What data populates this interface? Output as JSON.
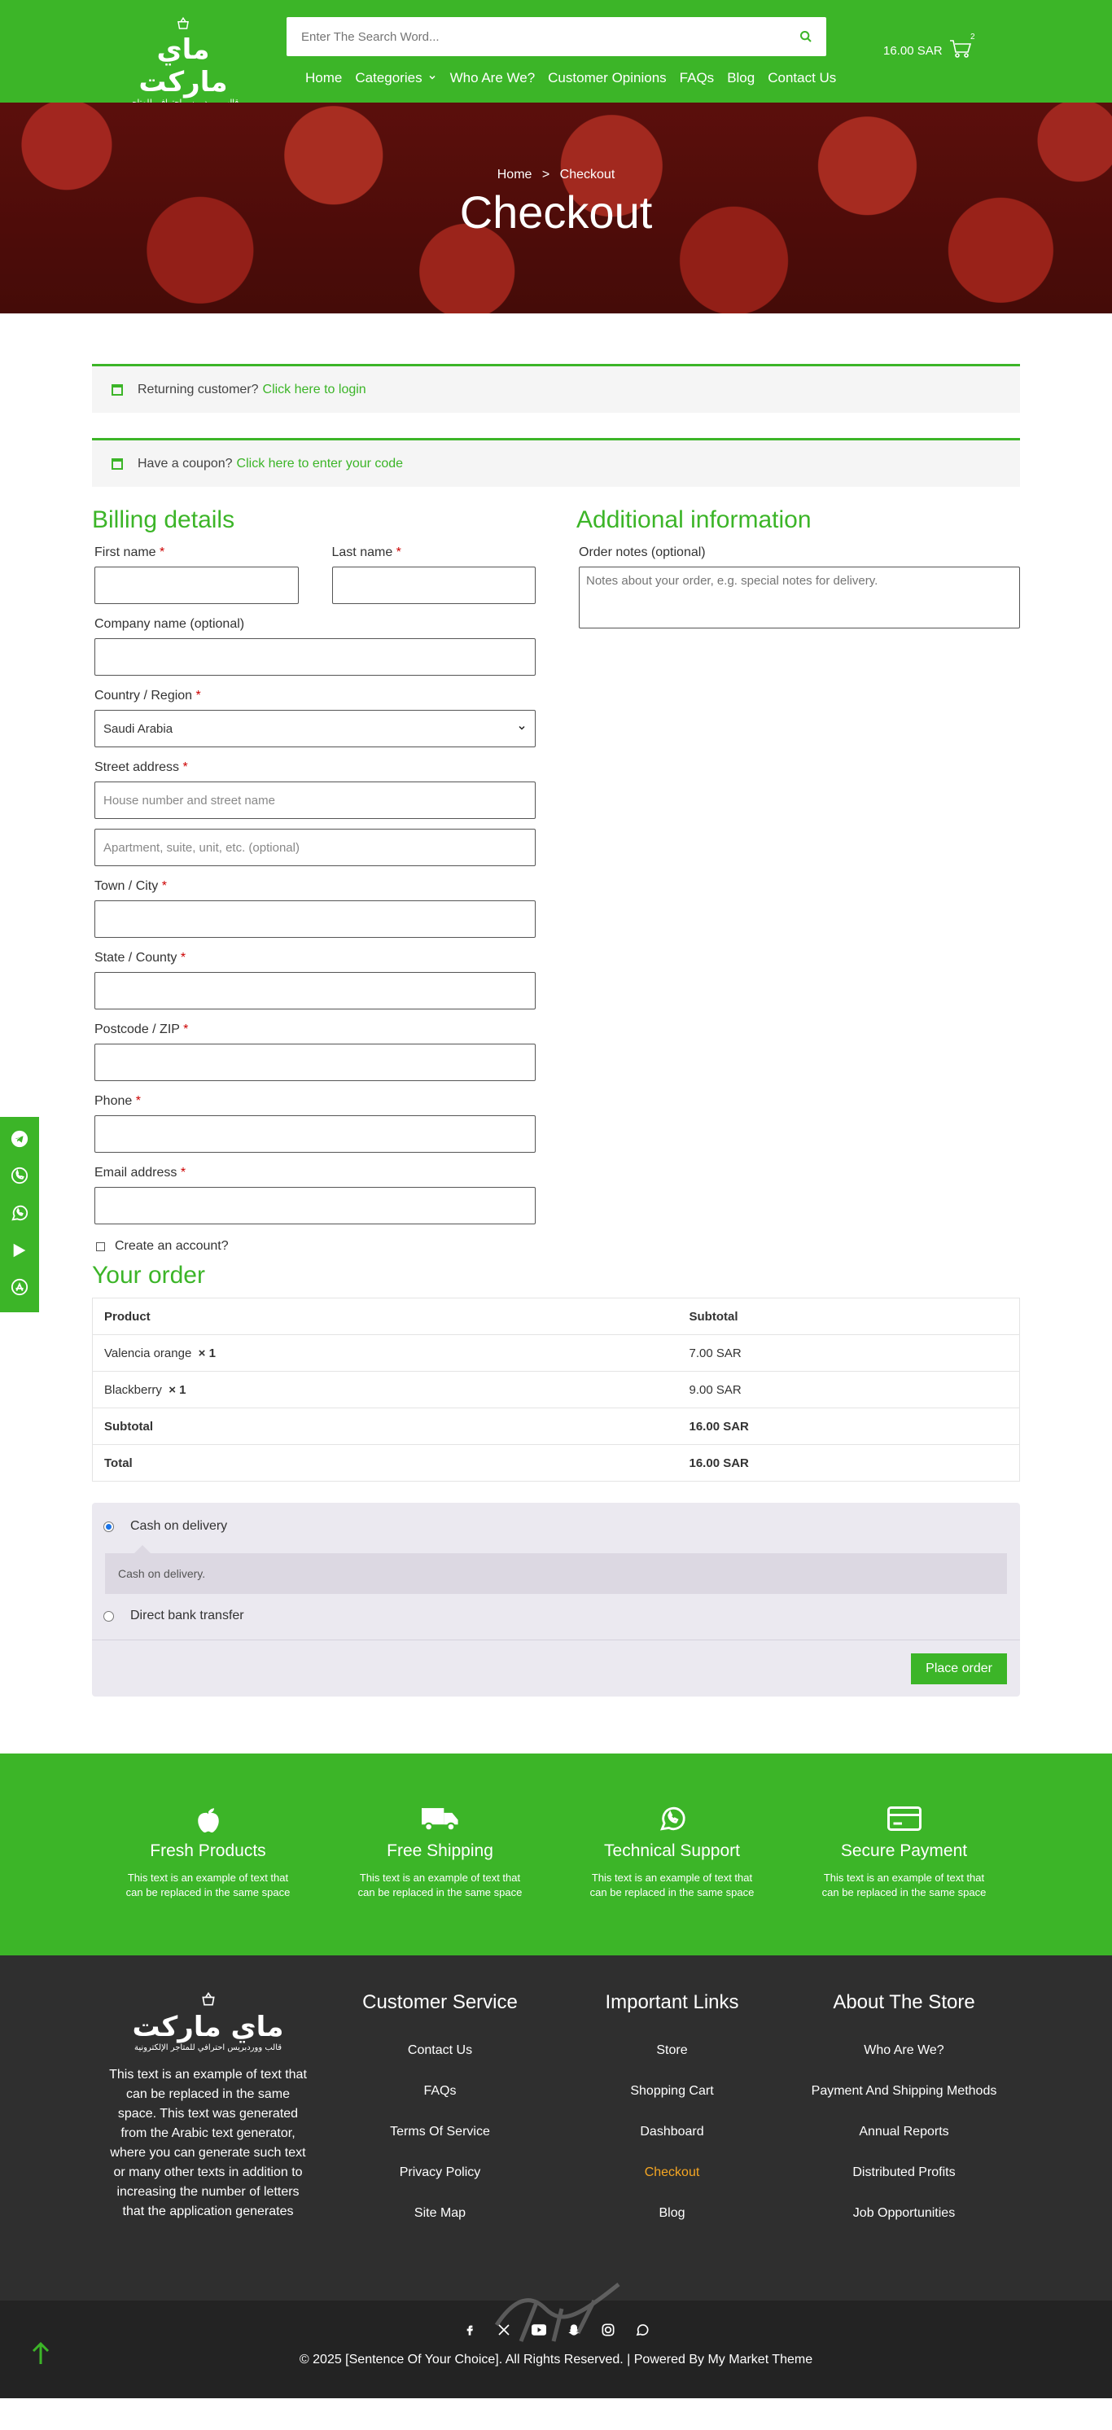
{
  "header": {
    "logo_name": "ماي ماركت",
    "logo_tagline": "قالب ووردبريس احترافي للمتاجر الإلكترونية",
    "search_placeholder": "Enter The Search Word...",
    "nav": [
      "Home",
      "Categories",
      "Who Are We?",
      "Customer Opinions",
      "FAQs",
      "Blog",
      "Contact Us"
    ],
    "cart_total": "16.00 SAR",
    "cart_count": "2"
  },
  "hero": {
    "breadcrumb_home": "Home",
    "breadcrumb_sep": ">",
    "breadcrumb_current": "Checkout",
    "title": "Checkout"
  },
  "notices": {
    "login_text": "Returning customer?",
    "login_link": "Click here to login",
    "coupon_text": "Have a coupon?",
    "coupon_link": "Click here to enter your code"
  },
  "billing": {
    "title": "Billing details",
    "first_name": "First name",
    "last_name": "Last name",
    "company": "Company name (optional)",
    "country": "Country / Region",
    "country_value": "Saudi Arabia",
    "street": "Street address",
    "street_ph1": "House number and street name",
    "street_ph2": "Apartment, suite, unit, etc. (optional)",
    "town": "Town / City",
    "state": "State / County",
    "postcode": "Postcode / ZIP",
    "phone": "Phone",
    "email": "Email address",
    "required_mark": "*",
    "create_account": "Create an account?"
  },
  "additional": {
    "title": "Additional information",
    "notes_label": "Order notes (optional)",
    "notes_placeholder": "Notes about your order, e.g. special notes for delivery."
  },
  "order": {
    "title": "Your order",
    "col_product": "Product",
    "col_subtotal": "Subtotal",
    "items": [
      {
        "name": "Valencia orange",
        "qty": "× 1",
        "price": "7.00 SAR"
      },
      {
        "name": "Blackberry",
        "qty": "× 1",
        "price": "9.00 SAR"
      }
    ],
    "subtotal_label": "Subtotal",
    "subtotal_value": "16.00 SAR",
    "total_label": "Total",
    "total_value": "16.00 SAR"
  },
  "payment": {
    "cod": "Cash on delivery",
    "cod_desc": "Cash on delivery.",
    "bank": "Direct bank transfer",
    "place_order": "Place order"
  },
  "features": [
    {
      "title": "Fresh Products",
      "text": "This text is an example of text that can be replaced in the same space"
    },
    {
      "title": "Free Shipping",
      "text": "This text is an example of text that can be replaced in the same space"
    },
    {
      "title": "Technical Support",
      "text": "This text is an example of text that can be replaced in the same space"
    },
    {
      "title": "Secure Payment",
      "text": "This text is an example of text that can be replaced in the same space"
    }
  ],
  "footer": {
    "about_text": "This text is an example of text that can be replaced in the same space. This text was generated from the Arabic text generator, where you can generate such text or many other texts in addition to increasing the number of letters that the application generates",
    "customer_service": {
      "title": "Customer Service",
      "links": [
        "Contact Us",
        "FAQs",
        "Terms Of Service",
        "Privacy Policy",
        "Site Map"
      ]
    },
    "important_links": {
      "title": "Important Links",
      "links": [
        "Store",
        "Shopping Cart",
        "Dashboard",
        "Checkout",
        "Blog"
      ]
    },
    "about_store": {
      "title": "About The Store",
      "links": [
        "Who Are We?",
        "Payment And Shipping Methods",
        "Annual Reports",
        "Distributed Profits",
        "Job Opportunities"
      ]
    },
    "copyright": "© 2025 [Sentence Of Your Choice]. All Rights Reserved. | Powered By My Market Theme"
  },
  "colors": {
    "brand": "#3cb528",
    "footer": "#2f2f2f",
    "highlight": "#f5a623"
  }
}
